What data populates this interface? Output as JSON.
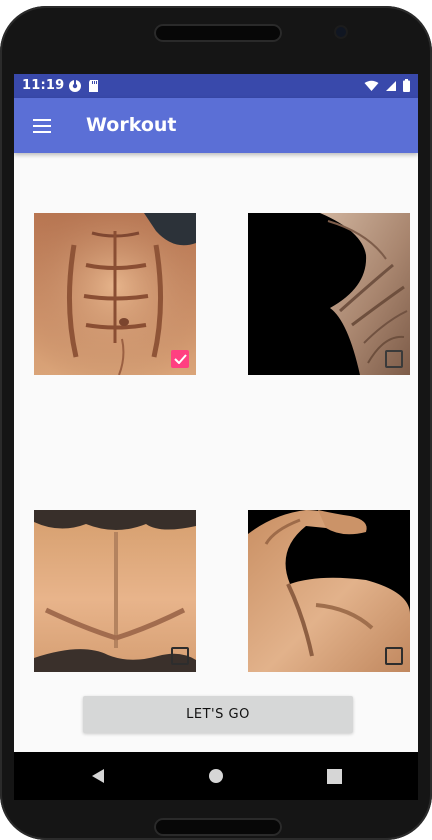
{
  "status_bar": {
    "time": "11:19",
    "left_icons": [
      "app-notification-icon",
      "sd-card-icon"
    ],
    "right_icons": [
      "wifi-icon",
      "signal-icon",
      "battery-icon"
    ],
    "colors": {
      "background": "#3949ab",
      "text": "#ffffff"
    }
  },
  "app_bar": {
    "title": "Workout",
    "menu_icon": "hamburger-menu-icon",
    "colors": {
      "background": "#5b6fd6",
      "text": "#ffffff"
    }
  },
  "workouts": [
    {
      "name": "abs",
      "checked": true
    },
    {
      "name": "arm-veins",
      "checked": false
    },
    {
      "name": "chest",
      "checked": false
    },
    {
      "name": "biceps",
      "checked": false
    }
  ],
  "action": {
    "label": "LET'S GO"
  },
  "navigation": {
    "back_icon": "back-icon",
    "home_icon": "home-icon",
    "recents_icon": "recents-icon"
  },
  "colors": {
    "accent": "#ff4081",
    "background": "#fafafa",
    "button": "#d6d7d7"
  }
}
